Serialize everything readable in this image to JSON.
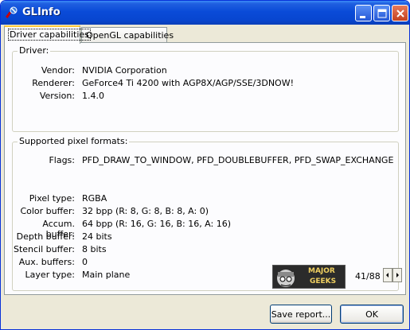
{
  "window": {
    "title": "GLInfo"
  },
  "tabs": [
    {
      "label": "Driver capabilities",
      "active": true
    },
    {
      "label": "OpenGL capabilities",
      "active": false
    }
  ],
  "driver": {
    "group_label": "Driver:",
    "fields": [
      {
        "label": "Vendor:",
        "value": "NVIDIA Corporation"
      },
      {
        "label": "Renderer:",
        "value": "GeForce4 Ti 4200 with AGP8X/AGP/SSE/3DNOW!"
      },
      {
        "label": "Version:",
        "value": "1.4.0"
      }
    ]
  },
  "pixel_formats": {
    "group_label": "Supported pixel formats:",
    "flags_label": "Flags:",
    "flags_value": "PFD_DRAW_TO_WINDOW, PFD_DOUBLEBUFFER, PFD_SWAP_EXCHANGE",
    "fields": [
      {
        "label": "Pixel type:",
        "value": "RGBA"
      },
      {
        "label": "Color buffer:",
        "value": "32 bpp (R: 8, G: 8, B: 8, A: 0)"
      },
      {
        "label": "Accum. buffer:",
        "value": "64 bpp (R: 16, G: 16, B: 16, A: 16)"
      },
      {
        "label": "Depth buffer:",
        "value": "24 bits"
      },
      {
        "label": "Stencil buffer:",
        "value": "8 bits"
      },
      {
        "label": "Aux. buffers:",
        "value": "0"
      },
      {
        "label": "Layer type:",
        "value": "Main plane"
      }
    ],
    "counter": "41/88",
    "logo_text": [
      "MAJOR",
      "GEEKS"
    ]
  },
  "buttons": {
    "save": "Save report...",
    "ok": "OK"
  },
  "colors": {
    "titlebar": "#0a4bd8",
    "face": "#ece9d8",
    "panel": "#fcfcfe",
    "active_tab_accent": "#ffc83c"
  }
}
